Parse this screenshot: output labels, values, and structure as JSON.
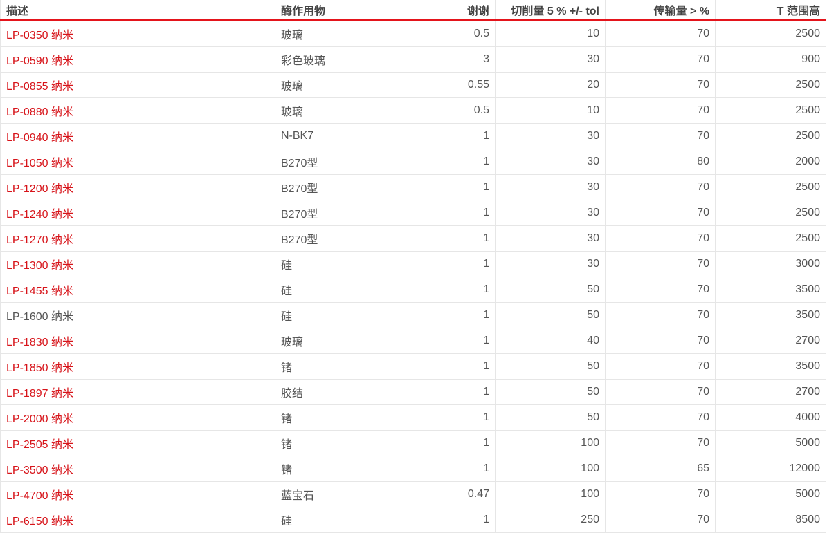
{
  "table": {
    "headers": [
      "描述",
      "酶作用物",
      "谢谢",
      "切削量 5 % +/- tol",
      "传输量 > %",
      "T 范围高"
    ],
    "rows": [
      {
        "description": "LP-0350 纳米",
        "substrate": "玻璃",
        "thanks": "0.5",
        "cut": "10",
        "transmission": "70",
        "range": "2500",
        "linked": true
      },
      {
        "description": "LP-0590 纳米",
        "substrate": "彩色玻璃",
        "thanks": "3",
        "cut": "30",
        "transmission": "70",
        "range": "900",
        "linked": true
      },
      {
        "description": "LP-0855 纳米",
        "substrate": "玻璃",
        "thanks": "0.55",
        "cut": "20",
        "transmission": "70",
        "range": "2500",
        "linked": true
      },
      {
        "description": "LP-0880 纳米",
        "substrate": "玻璃",
        "thanks": "0.5",
        "cut": "10",
        "transmission": "70",
        "range": "2500",
        "linked": true
      },
      {
        "description": "LP-0940 纳米",
        "substrate": "N-BK7",
        "thanks": "1",
        "cut": "30",
        "transmission": "70",
        "range": "2500",
        "linked": true
      },
      {
        "description": "LP-1050 纳米",
        "substrate": "B270型",
        "thanks": "1",
        "cut": "30",
        "transmission": "80",
        "range": "2000",
        "linked": true
      },
      {
        "description": "LP-1200 纳米",
        "substrate": "B270型",
        "thanks": "1",
        "cut": "30",
        "transmission": "70",
        "range": "2500",
        "linked": true
      },
      {
        "description": "LP-1240 纳米",
        "substrate": "B270型",
        "thanks": "1",
        "cut": "30",
        "transmission": "70",
        "range": "2500",
        "linked": true
      },
      {
        "description": "LP-1270 纳米",
        "substrate": "B270型",
        "thanks": "1",
        "cut": "30",
        "transmission": "70",
        "range": "2500",
        "linked": true
      },
      {
        "description": "LP-1300 纳米",
        "substrate": "硅",
        "thanks": "1",
        "cut": "30",
        "transmission": "70",
        "range": "3000",
        "linked": true
      },
      {
        "description": "LP-1455 纳米",
        "substrate": "硅",
        "thanks": "1",
        "cut": "50",
        "transmission": "70",
        "range": "3500",
        "linked": true
      },
      {
        "description": "LP-1600 纳米",
        "substrate": "硅",
        "thanks": "1",
        "cut": "50",
        "transmission": "70",
        "range": "3500",
        "linked": false
      },
      {
        "description": "LP-1830 纳米",
        "substrate": "玻璃",
        "thanks": "1",
        "cut": "40",
        "transmission": "70",
        "range": "2700",
        "linked": true
      },
      {
        "description": "LP-1850 纳米",
        "substrate": "锗",
        "thanks": "1",
        "cut": "50",
        "transmission": "70",
        "range": "3500",
        "linked": true
      },
      {
        "description": "LP-1897 纳米",
        "substrate": "胶结",
        "thanks": "1",
        "cut": "50",
        "transmission": "70",
        "range": "2700",
        "linked": true
      },
      {
        "description": "LP-2000 纳米",
        "substrate": "锗",
        "thanks": "1",
        "cut": "50",
        "transmission": "70",
        "range": "4000",
        "linked": true
      },
      {
        "description": "LP-2505 纳米",
        "substrate": "锗",
        "thanks": "1",
        "cut": "100",
        "transmission": "70",
        "range": "5000",
        "linked": true
      },
      {
        "description": "LP-3500 纳米",
        "substrate": "锗",
        "thanks": "1",
        "cut": "100",
        "transmission": "65",
        "range": "12000",
        "linked": true
      },
      {
        "description": "LP-4700 纳米",
        "substrate": "蓝宝石",
        "thanks": "0.47",
        "cut": "100",
        "transmission": "70",
        "range": "5000",
        "linked": true
      },
      {
        "description": "LP-6150 纳米",
        "substrate": "硅",
        "thanks": "1",
        "cut": "250",
        "transmission": "70",
        "range": "8500",
        "linked": true
      }
    ]
  },
  "colors": {
    "link": "#d7141a",
    "header_rule": "#e4141b",
    "text": "#555555",
    "grid": "#e6e6e6"
  }
}
